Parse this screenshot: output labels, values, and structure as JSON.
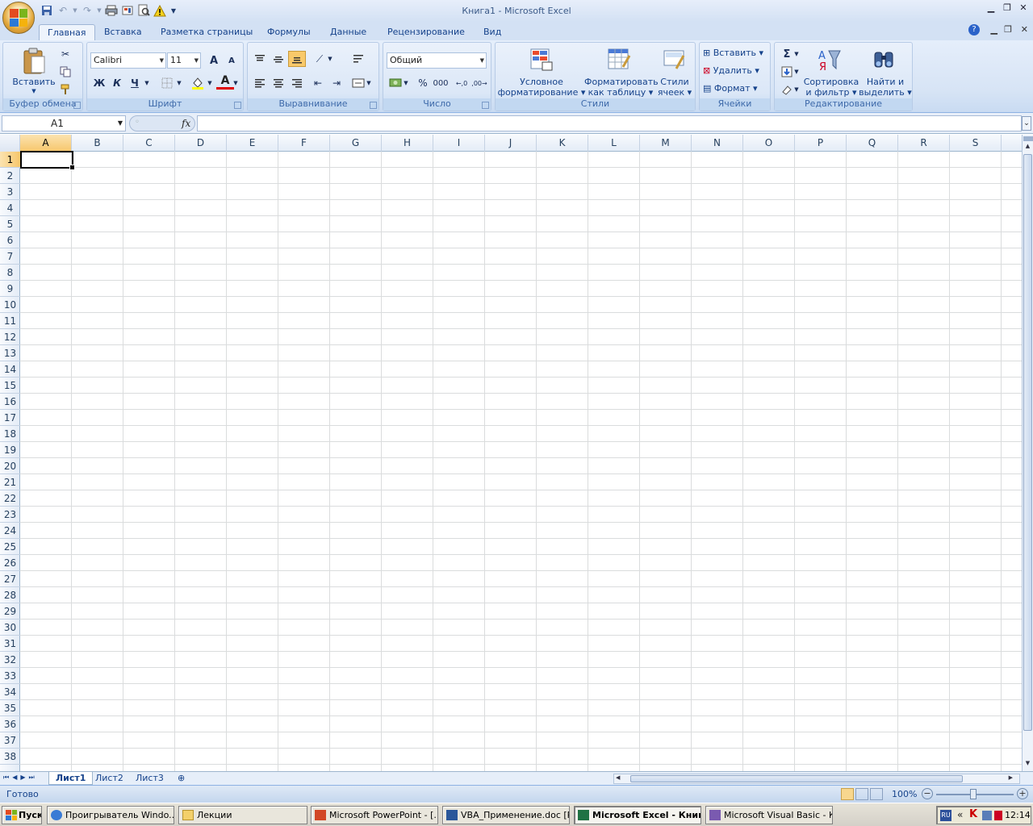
{
  "window": {
    "title": "Книга1  -  Microsoft Excel"
  },
  "tabs": [
    "Главная",
    "Вставка",
    "Разметка страницы",
    "Формулы",
    "Данные",
    "Рецензирование",
    "Вид"
  ],
  "ribbon": {
    "clipboard": {
      "label": "Буфер обмена",
      "paste": "Вставить"
    },
    "font": {
      "label": "Шрифт",
      "name": "Calibri",
      "size": "11",
      "bold": "Ж",
      "italic": "К",
      "underline": "Ч",
      "grow": "A",
      "shrink": "A",
      "color_letter": "A"
    },
    "alignment": {
      "label": "Выравнивание"
    },
    "number": {
      "label": "Число",
      "format": "Общий",
      "percent": "%",
      "thousands": "000"
    },
    "styles": {
      "label": "Стили",
      "conditional": "Условное",
      "conditional2": "форматирование",
      "format_table": "Форматировать",
      "format_table2": "как таблицу",
      "cell_styles": "Стили",
      "cell_styles2": "ячеек"
    },
    "cells": {
      "label": "Ячейки",
      "insert": "Вставить",
      "delete": "Удалить",
      "format": "Формат"
    },
    "editing": {
      "label": "Редактирование",
      "sum": "Σ",
      "sort": "Сортировка",
      "sort2": "и фильтр",
      "find": "Найти и",
      "find2": "выделить"
    }
  },
  "formula_bar": {
    "name_box": "A1",
    "fx": "fx",
    "content": ""
  },
  "columns": [
    "A",
    "B",
    "C",
    "D",
    "E",
    "F",
    "G",
    "H",
    "I",
    "J",
    "K",
    "L",
    "M",
    "N",
    "O",
    "P",
    "Q",
    "R",
    "S"
  ],
  "rows": [
    "1",
    "2",
    "3",
    "4",
    "5",
    "6",
    "7",
    "8",
    "9",
    "10",
    "11",
    "12",
    "13",
    "14",
    "15",
    "16",
    "17",
    "18",
    "19",
    "20",
    "21",
    "22",
    "23",
    "24",
    "25",
    "26",
    "27",
    "28",
    "29",
    "30",
    "31",
    "32",
    "33",
    "34",
    "35",
    "36",
    "37",
    "38"
  ],
  "sheets": [
    "Лист1",
    "Лист2",
    "Лист3"
  ],
  "status": {
    "ready": "Готово",
    "zoom": "100%"
  },
  "taskbar": {
    "start": "Пуск",
    "items": [
      "Проигрыватель Windo...",
      "Лекции",
      "Microsoft PowerPoint - [...",
      "VBA_Применение.doc [Р...",
      "Microsoft Excel - Книг...",
      "Microsoft Visual Basic - К..."
    ],
    "lang": "RU",
    "clock": "12:14"
  },
  "colors": {
    "accent": "#15428b",
    "selection": "#f7c66b",
    "ribbon": "#dbe7f7"
  }
}
